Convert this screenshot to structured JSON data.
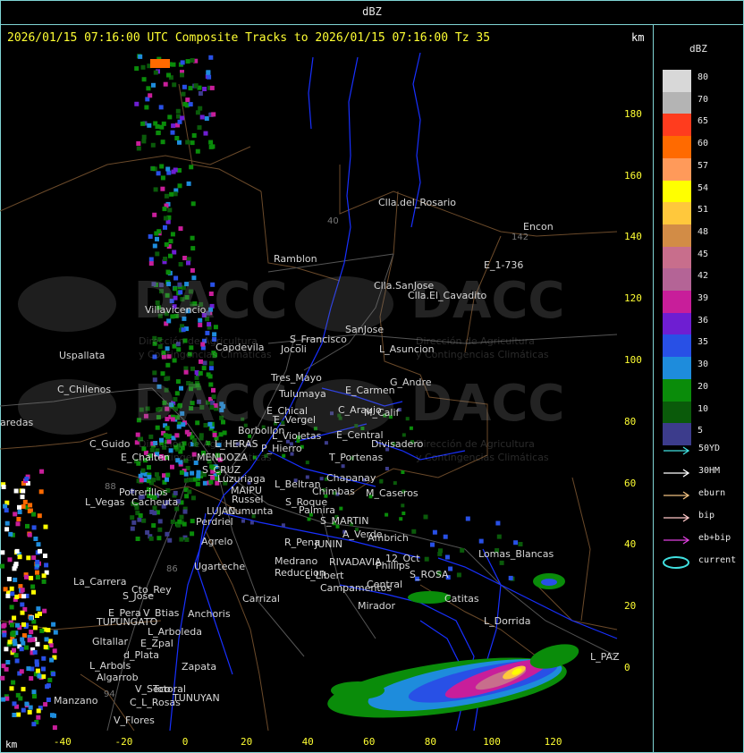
{
  "title": "dBZ",
  "header": {
    "text": "2026/01/15 07:16:00 UTC Composite Tracks to 2026/01/15 07:16:00 Tz 35",
    "unit": "km"
  },
  "axes": {
    "x_ticks": [
      "-40",
      "-20",
      "0",
      "20",
      "40",
      "60",
      "80",
      "100",
      "120"
    ],
    "y_ticks": [
      "180",
      "160",
      "140",
      "120",
      "100",
      "80",
      "60",
      "40",
      "20",
      "0"
    ],
    "x_unit": "km"
  },
  "legend": {
    "title": "dBZ",
    "levels": [
      {
        "label": "80",
        "color": "#d8d8d8"
      },
      {
        "label": "70",
        "color": "#b4b4b4"
      },
      {
        "label": "65",
        "color": "#ff3c1e"
      },
      {
        "label": "60",
        "color": "#ff6a00"
      },
      {
        "label": "57",
        "color": "#ff9a5a"
      },
      {
        "label": "54",
        "color": "#ffff00"
      },
      {
        "label": "51",
        "color": "#ffc83c"
      },
      {
        "label": "48",
        "color": "#d28c46"
      },
      {
        "label": "45",
        "color": "#c86e8c"
      },
      {
        "label": "42",
        "color": "#b46496"
      },
      {
        "label": "39",
        "color": "#c81e9a"
      },
      {
        "label": "36",
        "color": "#6e1ed2"
      },
      {
        "label": "35",
        "color": "#2850e6"
      },
      {
        "label": "30",
        "color": "#1e8cdc"
      },
      {
        "label": "20",
        "color": "#0a8c0a"
      },
      {
        "label": "10",
        "color": "#0a5a0a"
      },
      {
        "label": "5",
        "color": "#3c3c8c"
      }
    ],
    "tracks": [
      {
        "label": "50YD",
        "color": "#40e0e0"
      },
      {
        "label": "30HM",
        "color": "#ffffff"
      },
      {
        "label": "eburn",
        "color": "#f0c080"
      },
      {
        "label": "bip",
        "color": "#ffc8c8"
      },
      {
        "label": "eb+bip",
        "color": "#e040e0"
      },
      {
        "label": "current",
        "color": "#40e0e0"
      }
    ]
  },
  "watermark": {
    "brand": "DACC",
    "line1": "Dirección de Agricultura",
    "line2": "y Contingencias Climáticas"
  },
  "cities": [
    {
      "name": "Clla.del_Rosario"
    },
    {
      "name": "Encon"
    },
    {
      "name": "E_1-736"
    },
    {
      "name": "Ramblon"
    },
    {
      "name": "Clla.SanJose"
    },
    {
      "name": "Clla.El_Cavadito"
    },
    {
      "name": "Villavicencio"
    },
    {
      "name": "Capdevila"
    },
    {
      "name": "S_Francisco"
    },
    {
      "name": "SanJose"
    },
    {
      "name": "Uspallata"
    },
    {
      "name": "Jocoli"
    },
    {
      "name": "L_Asuncion"
    },
    {
      "name": "Tres_Mayo"
    },
    {
      "name": "G_Andre"
    },
    {
      "name": "C_Chilenos"
    },
    {
      "name": "Tulumaya"
    },
    {
      "name": "E_Carmen"
    },
    {
      "name": "C_Araujo"
    },
    {
      "name": "E_Chical"
    },
    {
      "name": "M_Calif"
    },
    {
      "name": "E_Vergel"
    },
    {
      "name": "aredas"
    },
    {
      "name": "Borbollon"
    },
    {
      "name": "L_Violetas"
    },
    {
      "name": "E_Central"
    },
    {
      "name": "Divisadero"
    },
    {
      "name": "C_Guido"
    },
    {
      "name": "L_HERAS"
    },
    {
      "name": "P_Hierro"
    },
    {
      "name": "E_Chalten"
    },
    {
      "name": "MENDOZA"
    },
    {
      "name": "T_Portenas"
    },
    {
      "name": "S_CRUZ"
    },
    {
      "name": "Chapanay"
    },
    {
      "name": "Luzuriaga"
    },
    {
      "name": "L_Beltran"
    },
    {
      "name": "Potrerillos"
    },
    {
      "name": "MAIPU"
    },
    {
      "name": "Chimbas"
    },
    {
      "name": "M_Caseros"
    },
    {
      "name": "L_Vegas"
    },
    {
      "name": "Cacheuta"
    },
    {
      "name": "Russel"
    },
    {
      "name": "S_Roque"
    },
    {
      "name": "LUJAN"
    },
    {
      "name": "Cumunta"
    },
    {
      "name": "Palmira"
    },
    {
      "name": "Perdriel"
    },
    {
      "name": "S_MARTIN"
    },
    {
      "name": "A_Verde"
    },
    {
      "name": "Agrelo"
    },
    {
      "name": "Ambrich"
    },
    {
      "name": "R_Pena"
    },
    {
      "name": "JUNIN"
    },
    {
      "name": "Lomas_Blancas"
    },
    {
      "name": "Ugarteche"
    },
    {
      "name": "Medrano"
    },
    {
      "name": "RIVADAVIA"
    },
    {
      "name": "Phillips"
    },
    {
      "name": "12_Oct"
    },
    {
      "name": "Reduccion"
    },
    {
      "name": "L_Libert"
    },
    {
      "name": "S_ROSA"
    },
    {
      "name": "La_Carrera"
    },
    {
      "name": "Cto_Rey"
    },
    {
      "name": "Campamentos"
    },
    {
      "name": "Central"
    },
    {
      "name": "Catitas"
    },
    {
      "name": "S_Jose"
    },
    {
      "name": "Carrizal"
    },
    {
      "name": "Mirador"
    },
    {
      "name": "E_Pera"
    },
    {
      "name": "V_Btias"
    },
    {
      "name": "Anchoris"
    },
    {
      "name": "TUPUNGATO"
    },
    {
      "name": "L_Dorrida"
    },
    {
      "name": "L_Arboleda"
    },
    {
      "name": "Gltallar"
    },
    {
      "name": "E_Zpal"
    },
    {
      "name": "L_PAZ"
    },
    {
      "name": "d_Plata"
    },
    {
      "name": "L_Arbols"
    },
    {
      "name": "Zapata"
    },
    {
      "name": "Algarrob"
    },
    {
      "name": "V_Seco"
    },
    {
      "name": "Totoral"
    },
    {
      "name": "TUNUYAN"
    },
    {
      "name": "Manzano"
    },
    {
      "name": "C_L_Rosas"
    },
    {
      "name": "V_Flores"
    }
  ],
  "route_numbers": [
    "40",
    "142",
    "88",
    "86",
    "94"
  ]
}
